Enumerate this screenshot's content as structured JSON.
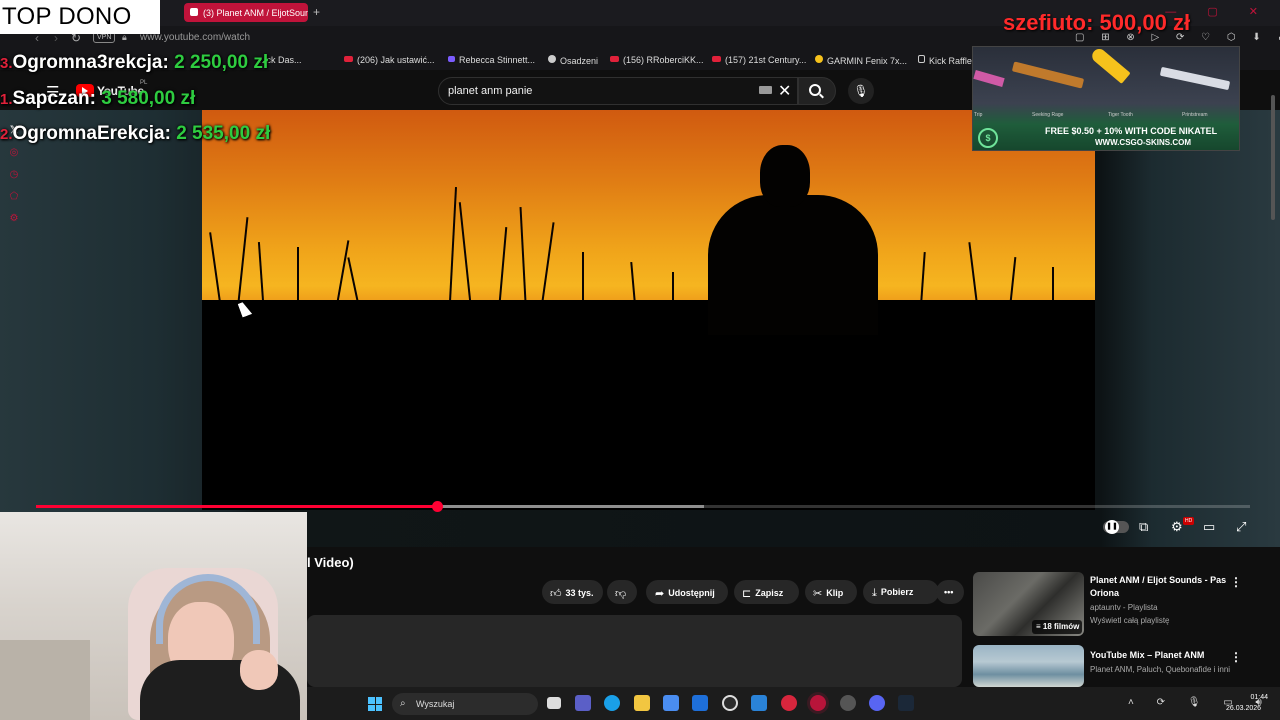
{
  "browser": {
    "active_tab": "(3) Planet ANM / EljotSoun",
    "new_tab": "+",
    "url": "www.youtube.com/watch",
    "vpn": "VPN",
    "bookmarks": [
      "(206) Jak ustawić...",
      "Rebecca Stinnett...",
      "Osadzeni",
      "(156) RRoberciKK...",
      "(157) 21st Century...",
      "GARMIN Fenix 7x...",
      "Kick Raffle",
      "...ck Das..."
    ]
  },
  "youtube": {
    "logo": "YouTube",
    "country": "PL",
    "search_value": "planet anm panie",
    "video_title_fragment": "l Video)",
    "likes": "33 tys.",
    "share": "Udostępnij",
    "save": "Zapisz",
    "clip": "Klip",
    "download": "Pobierz",
    "progress_played": 0.33,
    "progress_buffered": 0.55
  },
  "suggestions": [
    {
      "title": "Planet ANM / Eljot Sounds - Pas Oriona",
      "channel": "aptauntv - Playlista",
      "meta": "Wyświetl całą playlistę",
      "badge": "18 filmów"
    },
    {
      "title": "YouTube Mix – Planet ANM",
      "channel": "Planet ANM, Paluch, Quebonafide i inni",
      "meta": "",
      "badge": ""
    }
  ],
  "overlay": {
    "top_dono": "TOP DONO",
    "donors": [
      {
        "rank": "3.",
        "name": "Ogromna3rekcja:",
        "amount": "2 250,00 zł"
      },
      {
        "rank": "1.",
        "name": "Sapczan:",
        "amount": "3 580,00 zł"
      },
      {
        "rank": "2.",
        "name": "OgromnaErekcja:",
        "amount": "2 535,00 zł"
      }
    ],
    "szef": "szefiuto: 500,00 zł",
    "ad_line1": "FREE $0.50 + 10% WITH CODE NIKATEL",
    "ad_line2": "WWW.CSGO-SKINS.COM",
    "ad_labels": [
      "Trip",
      "Seeking Rage",
      "Tiger Tooth",
      "Printstream"
    ]
  },
  "taskbar": {
    "search": "Wyszukaj",
    "time": "01:44",
    "date": "26.03.2026"
  },
  "colors": {
    "accent_red": "#ff0033",
    "donor_amount": "#2ecc40",
    "tab_active": "#c0133a"
  }
}
